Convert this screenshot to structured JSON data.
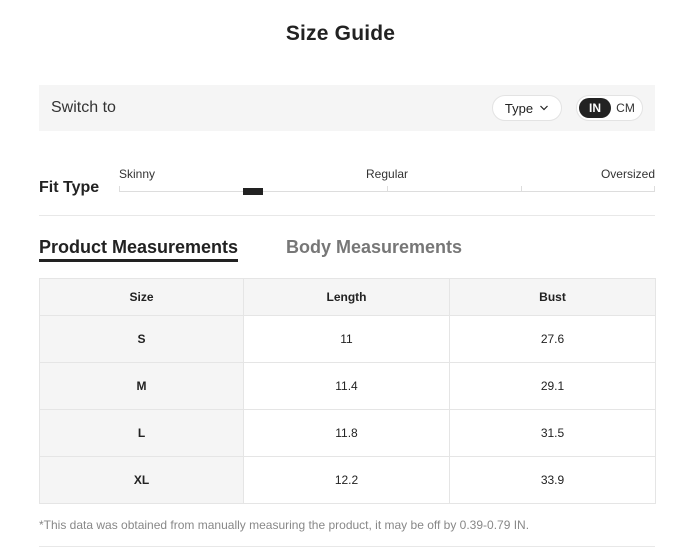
{
  "title": "Size Guide",
  "switch": {
    "label": "Switch to",
    "type_button": "Type",
    "units": [
      "IN",
      "CM"
    ],
    "active_unit": "IN"
  },
  "fit": {
    "label": "Fit Type",
    "options": [
      "Skinny",
      "Regular",
      "Oversized"
    ]
  },
  "tabs": {
    "product": "Product Measurements",
    "body": "Body Measurements",
    "active": "product"
  },
  "table": {
    "headers": [
      "Size",
      "Length",
      "Bust"
    ],
    "rows": [
      [
        "S",
        "11",
        "27.6"
      ],
      [
        "M",
        "11.4",
        "29.1"
      ],
      [
        "L",
        "11.8",
        "31.5"
      ],
      [
        "XL",
        "12.2",
        "33.9"
      ]
    ]
  },
  "note": "*This data was obtained from manually measuring the product, it may be off by 0.39-0.79 IN."
}
